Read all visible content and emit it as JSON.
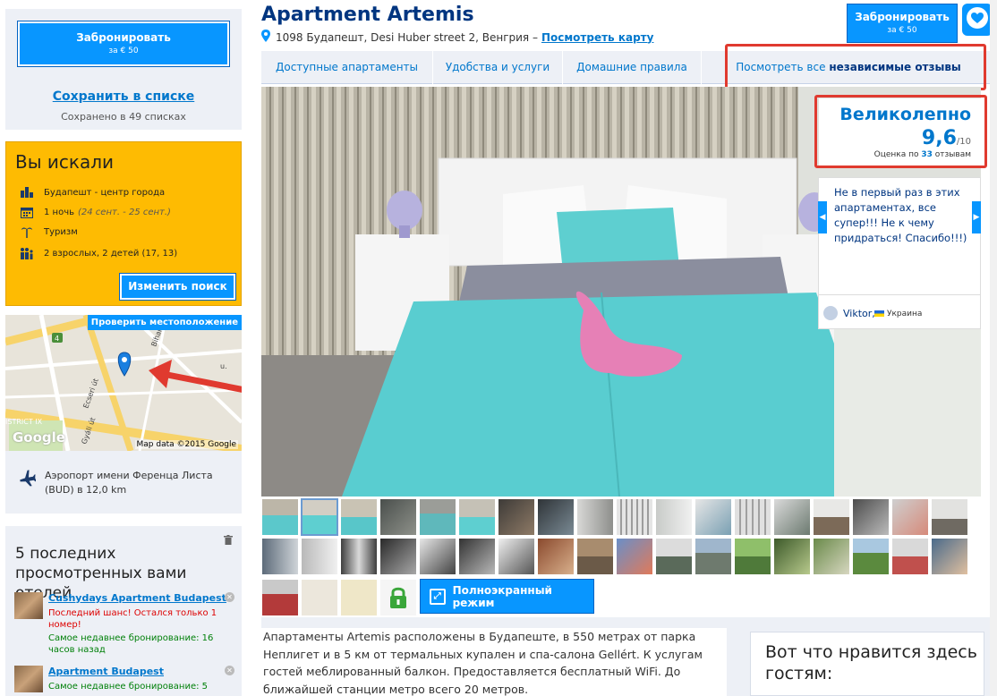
{
  "sidebar": {
    "reserve_label": "Забронировать",
    "reserve_price": "за € 50",
    "save_link": "Сохранить в списке",
    "saved_count": "Сохранено в 49 списках",
    "search": {
      "title": "Вы искали",
      "destination": "Будапешт - центр города",
      "nights": "1 ночь",
      "dates": "(24 сент. - 25 сент.)",
      "purpose": "Туризм",
      "guests": "2 взрослых, 2 детей (17, 13)",
      "change_button": "Изменить поиск"
    },
    "map": {
      "check_location": "Проверить местоположение",
      "credit": "Map data ©2015 Google",
      "google": "Google",
      "labels": {
        "route": "4",
        "street1": "Ecseri út",
        "street2": "Gyáli út",
        "district": "ISTRICT IX",
        "street3": "Bihari",
        "road_u": "u."
      }
    },
    "airport": "Аэропорт имени Ференца Листа (BUD) в 12,0 km",
    "recent": {
      "title": "5 последних просмотренных вами отелей",
      "items": [
        {
          "name": "Cushydays Apartment Budapest",
          "warning": "Последний шанс! Остался только 1 номер!",
          "booking": "Самое недавнее бронирование: 16 часов назад"
        },
        {
          "name": "Apartment Budapest",
          "booking": "Самое недавнее бронирование: 5"
        }
      ]
    }
  },
  "header": {
    "title": "Apartment Artemis",
    "address": "1098 Будапешт, Desi Huber street 2, Венгрия –",
    "map_link": "Посмотреть карту",
    "reserve_label": "Забронировать",
    "reserve_price": "за € 50"
  },
  "tabs": [
    "Доступные апартаменты",
    "Удобства и услуги",
    "Домашние правила"
  ],
  "reviews_tab": {
    "prefix": "Посмотреть все",
    "bold": "независимые отзывы"
  },
  "score": {
    "word": "Великолепно",
    "value": "9,6",
    "max": "/10",
    "sub_prefix": "Оценка по",
    "count": "33",
    "sub_suffix": "отзывам"
  },
  "review": {
    "text": "Не в первый раз в этих апартаментах, все супер!!! Не к чему придраться! Спасибо!!!)",
    "author": "Viktor,",
    "country": "Украина"
  },
  "gallery": {
    "fullscreen_label": "Полноэкранный режим"
  },
  "description": "Апартаменты Artemis расположены в Будапеште, в 550 метрах от парка Неплигет и в 5 км от термальных купален и спа-салона Gellért. К услугам гостей меблированный балкон. Предоставляется бесплатный WiFi. До ближайшей станции метро всего 20 метров.",
  "likes_title": "Вот что нравится здесь гостям:",
  "colors": {
    "accent": "#0896ff",
    "brand_dark": "#003580",
    "link": "#0077cc",
    "search_panel": "#febb02",
    "highlight": "#e03a2f",
    "panel_bg": "#edf0f6"
  }
}
